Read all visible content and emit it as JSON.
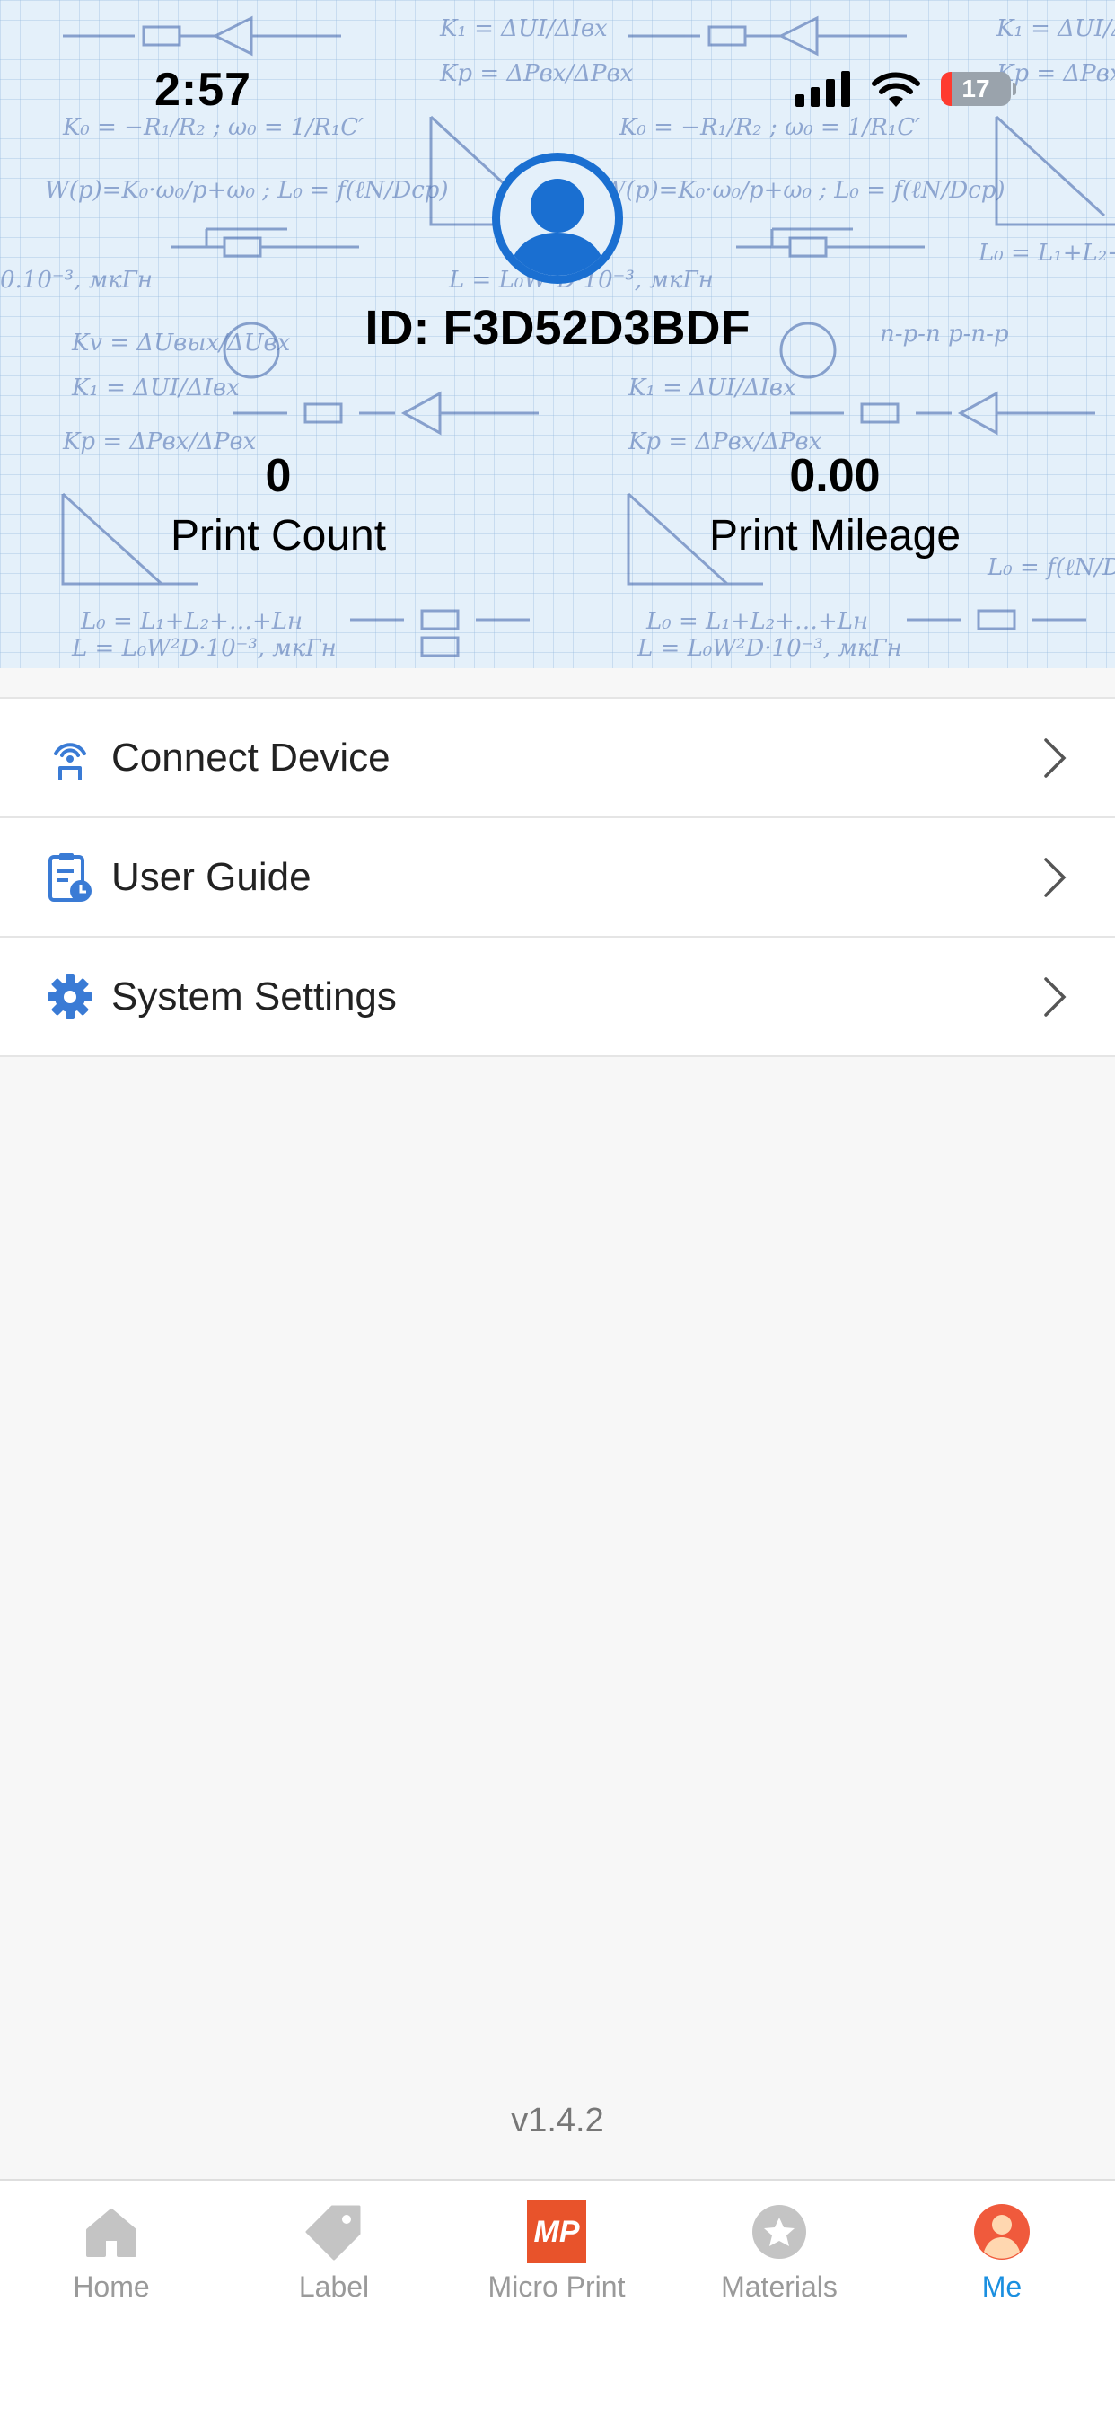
{
  "status_bar": {
    "time": "2:57",
    "battery": "17"
  },
  "profile": {
    "id_text": "ID: F3D52D3BDF",
    "stats": [
      {
        "value": "0",
        "label": "Print Count"
      },
      {
        "value": "0.00",
        "label": "Print Mileage"
      }
    ]
  },
  "menu": [
    {
      "label": "Connect Device",
      "icon": "signal-tower-icon"
    },
    {
      "label": "User Guide",
      "icon": "clipboard-clock-icon"
    },
    {
      "label": "System Settings",
      "icon": "gear-icon"
    }
  ],
  "version": "v1.4.2",
  "tabs": [
    {
      "label": "Home",
      "icon": "home-icon"
    },
    {
      "label": "Label",
      "icon": "tag-icon"
    },
    {
      "label": "Micro Print",
      "icon": "micro-print-logo",
      "logo_text": "MP"
    },
    {
      "label": "Materials",
      "icon": "materials-icon"
    },
    {
      "label": "Me",
      "icon": "user-icon",
      "active": true
    }
  ],
  "colors": {
    "accent": "#1a8fe0",
    "avatar": "#1a6fd1",
    "tab_inactive": "#9a9a9a",
    "micro_print": "#e8532b",
    "me_icon": "#f05a3c"
  }
}
